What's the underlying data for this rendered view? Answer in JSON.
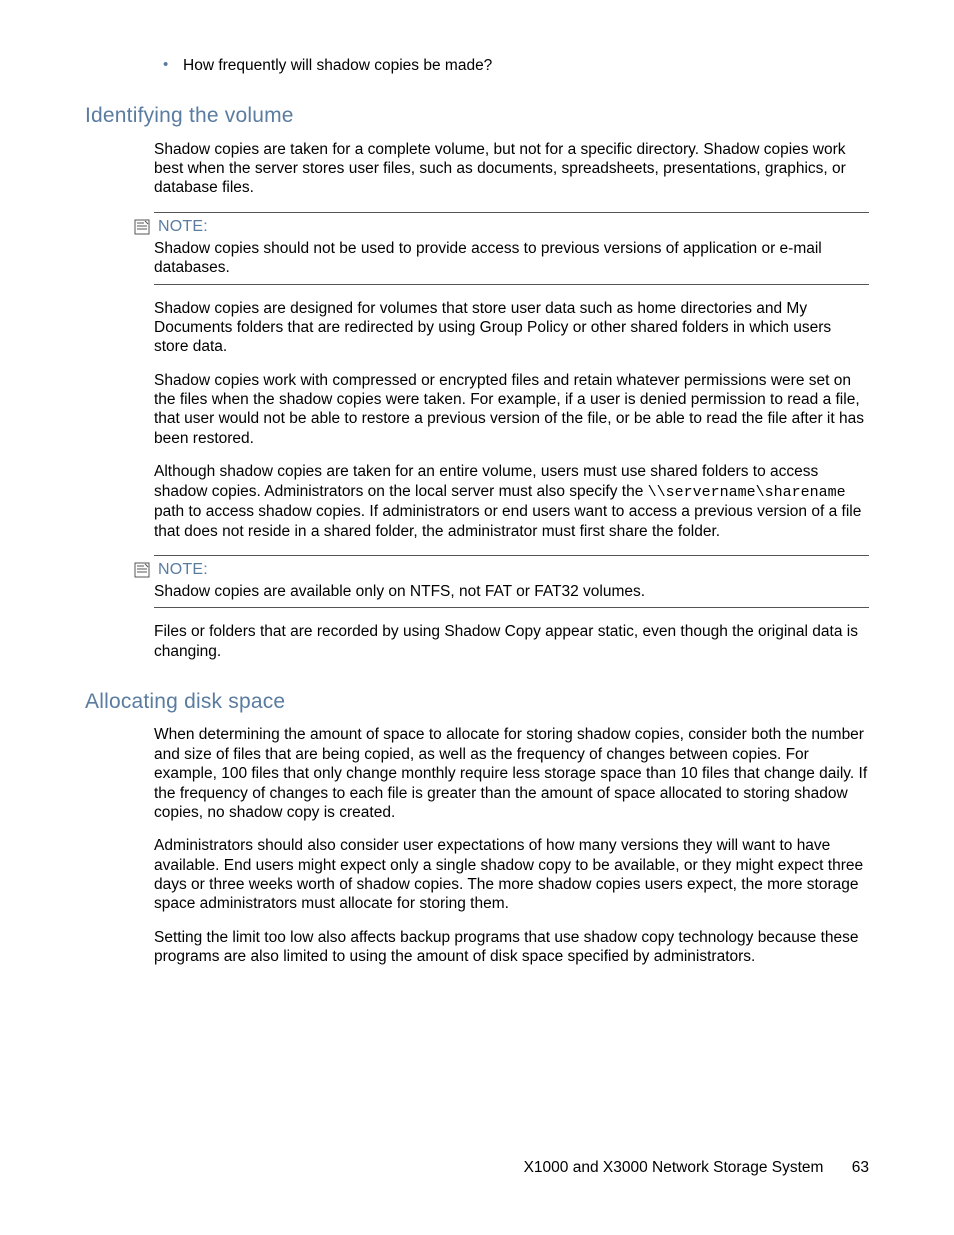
{
  "bullet1": "How frequently will shadow copies be made?",
  "sec1": {
    "title": "Identifying the volume",
    "p1": "Shadow copies are taken for a complete volume, but not for a specific directory. Shadow copies work best when the server stores user files, such as documents, spreadsheets, presentations, graphics, or database files.",
    "note1_label": "NOTE:",
    "note1_body": "Shadow copies should not be used to provide access to previous versions of application or e-mail databases.",
    "p2": "Shadow copies are designed for volumes that store user data such as home directories and My Documents folders that are redirected by using Group Policy or other shared folders in which users store data.",
    "p3": "Shadow copies work with compressed or encrypted files and retain whatever permissions were set on the files when the shadow copies were taken. For example, if a user is denied permission to read a file, that user would not be able to restore a previous version of the file, or be able to read the file after it has been restored.",
    "p4a": "Although shadow copies are taken for an entire volume, users must use shared folders to access shadow copies. Administrators on the local server must also specify the ",
    "p4_code": "\\\\servername\\sharename",
    "p4b": " path to access shadow copies. If administrators or end users want to access a previous version of a file that does not reside in a shared folder, the administrator must first share the folder.",
    "note2_label": "NOTE:",
    "note2_body": "Shadow copies are available only on NTFS, not FAT or FAT32 volumes.",
    "p5": "Files or folders that are recorded by using Shadow Copy appear static, even though the original data is changing."
  },
  "sec2": {
    "title": "Allocating disk space",
    "p1": "When determining the amount of space to allocate for storing shadow copies, consider both the number and size of files that are being copied, as well as the frequency of changes between copies. For example, 100 files that only change monthly require less storage space than 10 files that change daily. If the frequency of changes to each file is greater than the amount of space allocated to storing shadow copies, no shadow copy is created.",
    "p2": "Administrators should also consider user expectations of how many versions they will want to have available. End users might expect only a single shadow copy to be available, or they might expect three days or three weeks worth of shadow copies. The more shadow copies users expect, the more storage space administrators must allocate for storing them.",
    "p3": "Setting the limit too low also affects backup programs that use shadow copy technology because these programs are also limited to using the amount of disk space specified by administrators."
  },
  "footer": {
    "title": "X1000 and X3000 Network Storage System",
    "page": "63"
  }
}
